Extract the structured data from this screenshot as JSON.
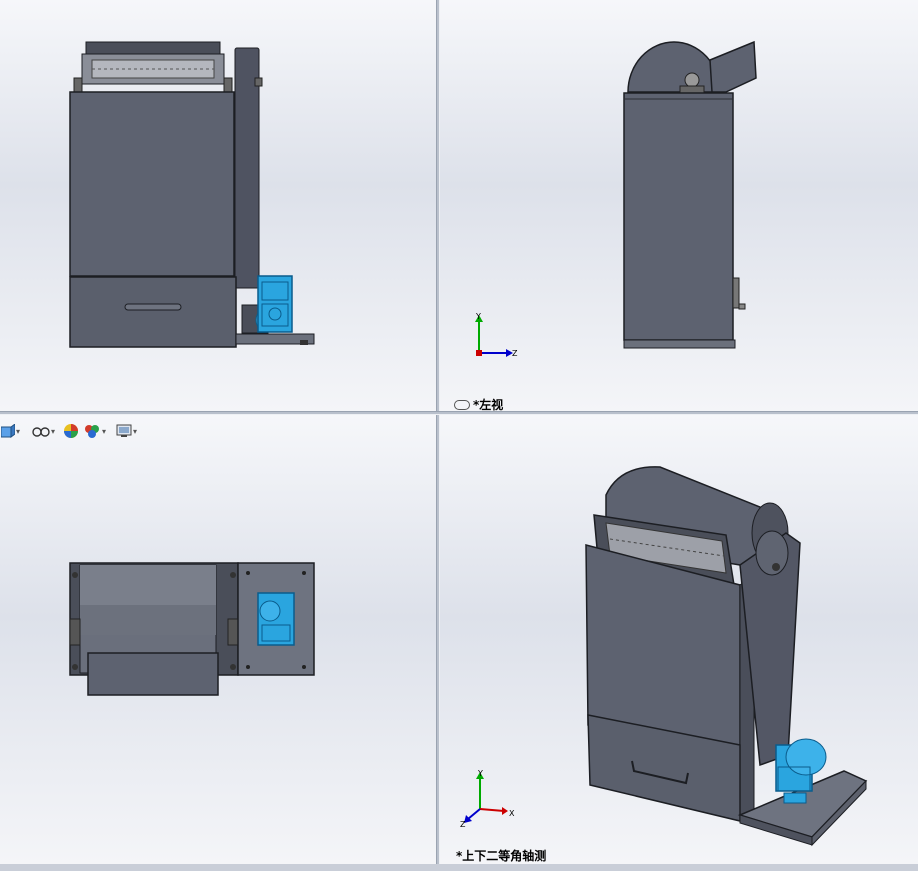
{
  "viewports": {
    "top_left": {
      "label": ""
    },
    "top_right": {
      "label": "*左视",
      "triad": {
        "y": "Y",
        "z": "Z"
      }
    },
    "bottom_left": {
      "label": ""
    },
    "bottom_right": {
      "label": "*上下二等角轴测",
      "triad": {
        "y": "Y",
        "x": "X",
        "z": "Z"
      }
    }
  },
  "view_toolbar": {
    "items": [
      "view-orientation-icon",
      "hide-show-items-icon",
      "edit-appearance-icon",
      "apply-scene-icon",
      "view-settings-icon"
    ]
  },
  "colors": {
    "body": "#5d6270",
    "body_dark": "#3d414b",
    "motor": "#29a6e0",
    "triad_x": "#cc0000",
    "triad_y": "#00aa00",
    "triad_z": "#0000cc"
  }
}
